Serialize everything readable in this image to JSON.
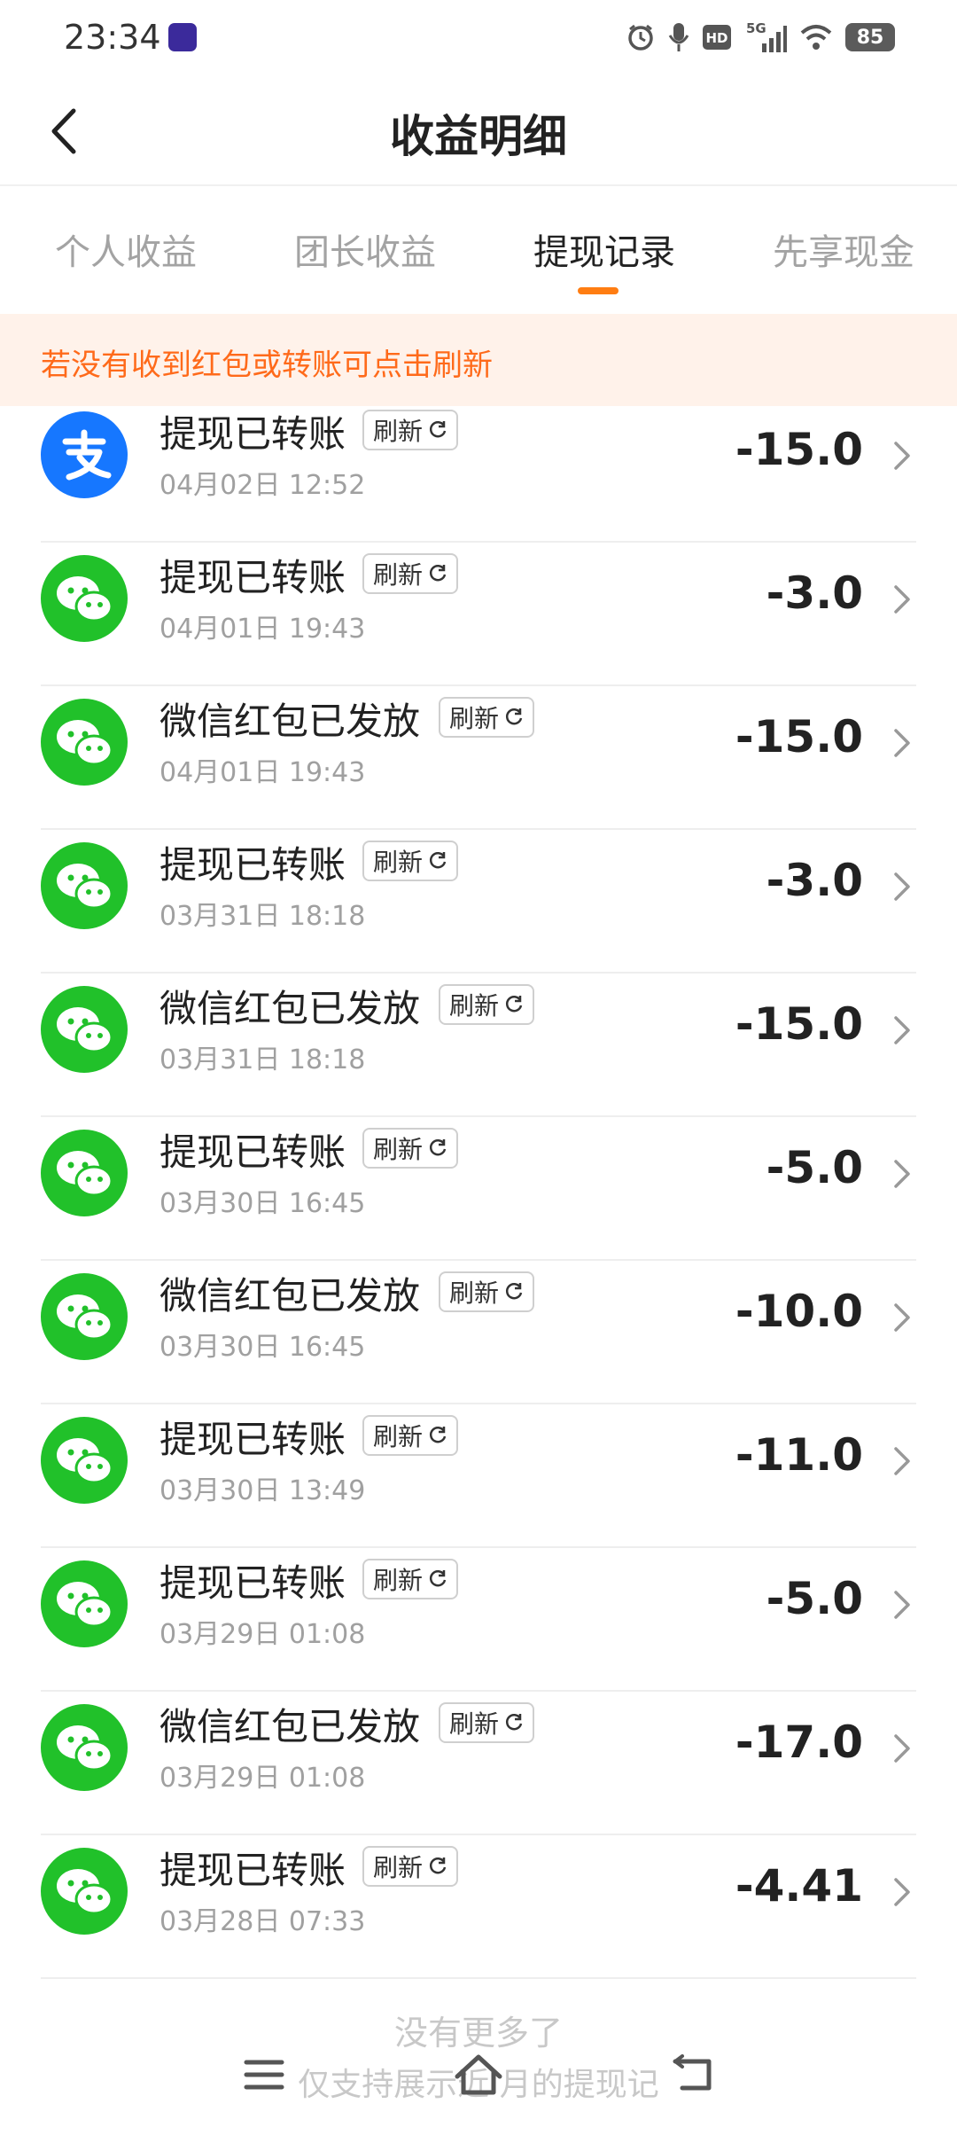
{
  "status_bar": {
    "time": "23:34",
    "battery": "85",
    "network": "5G",
    "hd": "HD",
    "icons": [
      "alarm-icon",
      "mic-icon",
      "hd-icon",
      "signal-icon",
      "wifi-icon",
      "battery-icon"
    ]
  },
  "header": {
    "title": "收益明细",
    "back_icon": "chevron-left-icon"
  },
  "tabs": [
    {
      "label": "个人收益",
      "active": false
    },
    {
      "label": "团长收益",
      "active": false
    },
    {
      "label": "提现记录",
      "active": true
    },
    {
      "label": "先享现金",
      "active": false
    }
  ],
  "notice": {
    "text": "若没有收到红包或转账可点击刷新"
  },
  "refresh_label": "刷新",
  "records": [
    {
      "title": "提现已转账",
      "date": "04月02日 12:52",
      "amount": "-15.0",
      "channel": "alipay"
    },
    {
      "title": "提现已转账",
      "date": "04月01日 19:43",
      "amount": "-3.0",
      "channel": "wechat"
    },
    {
      "title": "微信红包已发放",
      "date": "04月01日 19:43",
      "amount": "-15.0",
      "channel": "wechat"
    },
    {
      "title": "提现已转账",
      "date": "03月31日 18:18",
      "amount": "-3.0",
      "channel": "wechat"
    },
    {
      "title": "微信红包已发放",
      "date": "03月31日 18:18",
      "amount": "-15.0",
      "channel": "wechat"
    },
    {
      "title": "提现已转账",
      "date": "03月30日 16:45",
      "amount": "-5.0",
      "channel": "wechat"
    },
    {
      "title": "微信红包已发放",
      "date": "03月30日 16:45",
      "amount": "-10.0",
      "channel": "wechat"
    },
    {
      "title": "提现已转账",
      "date": "03月30日 13:49",
      "amount": "-11.0",
      "channel": "wechat"
    },
    {
      "title": "提现已转账",
      "date": "03月29日 01:08",
      "amount": "-5.0",
      "channel": "wechat"
    },
    {
      "title": "微信红包已发放",
      "date": "03月29日 01:08",
      "amount": "-17.0",
      "channel": "wechat"
    },
    {
      "title": "提现已转账",
      "date": "03月28日 07:33",
      "amount": "-4.41",
      "channel": "wechat"
    }
  ],
  "footer": {
    "no_more": "没有更多了",
    "range_note": "仅支持展示近    月的提现记"
  },
  "nav": {
    "menu_icon": "menu-icon",
    "home_icon": "home-icon",
    "back_icon": "back-icon"
  }
}
